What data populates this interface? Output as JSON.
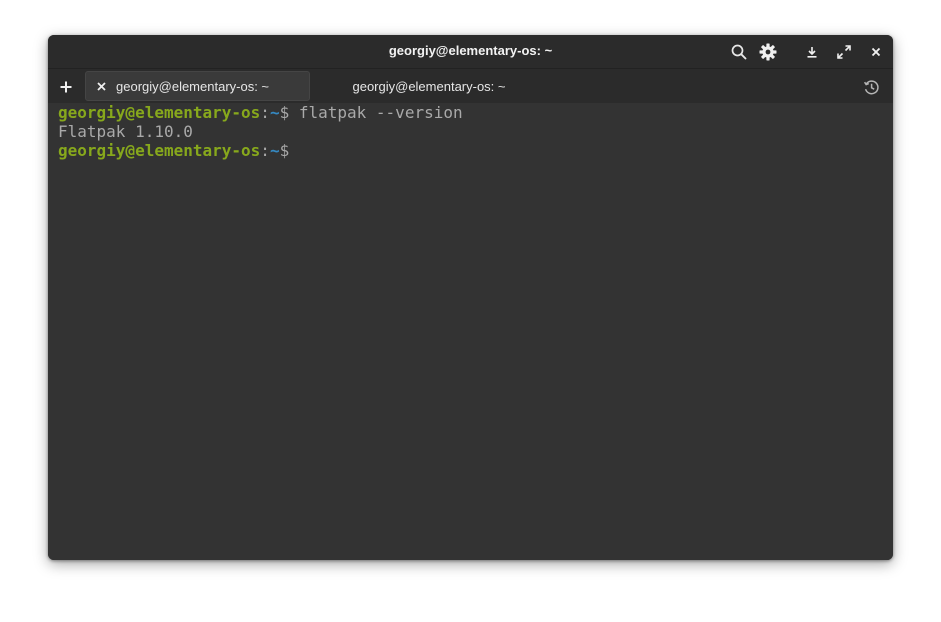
{
  "window": {
    "title": "georgiy@elementary-os: ~"
  },
  "tabs": [
    {
      "label": "georgiy@elementary-os: ~",
      "active": true
    },
    {
      "label": "georgiy@elementary-os: ~",
      "active": false
    }
  ],
  "icons": {
    "search": "search-icon",
    "settings": "gear-icon",
    "download": "download-icon",
    "maximize": "maximize-icon",
    "close": "close-icon",
    "new_tab": "plus-icon",
    "history": "history-icon"
  },
  "terminal": {
    "line1": {
      "user": "georgiy@elementary-os",
      "colon": ":",
      "path": "~",
      "dollar": "$",
      "command": " flatpak --version"
    },
    "line2": {
      "output": "Flatpak 1.10.0"
    },
    "line3": {
      "user": "georgiy@elementary-os",
      "colon": ":",
      "path": "~",
      "dollar": "$"
    }
  },
  "colors": {
    "background": "#333333",
    "user": "#87a81c",
    "path": "#3589c2",
    "text": "#a9a9a9"
  }
}
